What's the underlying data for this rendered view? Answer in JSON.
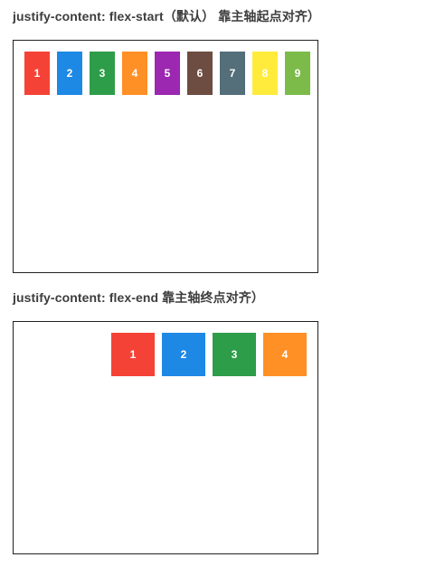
{
  "section1": {
    "title": "justify-content: flex-start（默认） 靠主轴起点对齐）",
    "items": [
      {
        "label": "1",
        "color": "#f44336"
      },
      {
        "label": "2",
        "color": "#1e88e5"
      },
      {
        "label": "3",
        "color": "#2e9d4a"
      },
      {
        "label": "4",
        "color": "#ff9026"
      },
      {
        "label": "5",
        "color": "#9c27b0"
      },
      {
        "label": "6",
        "color": "#6d4c41"
      },
      {
        "label": "7",
        "color": "#546e7a"
      },
      {
        "label": "8",
        "color": "#ffeb3b"
      },
      {
        "label": "9",
        "color": "#7cbb4a"
      }
    ]
  },
  "section2": {
    "title": "justify-content: flex-end 靠主轴终点对齐）",
    "items": [
      {
        "label": "1",
        "color": "#f44336"
      },
      {
        "label": "2",
        "color": "#1e88e5"
      },
      {
        "label": "3",
        "color": "#2e9d4a"
      },
      {
        "label": "4",
        "color": "#ff9026"
      }
    ]
  }
}
